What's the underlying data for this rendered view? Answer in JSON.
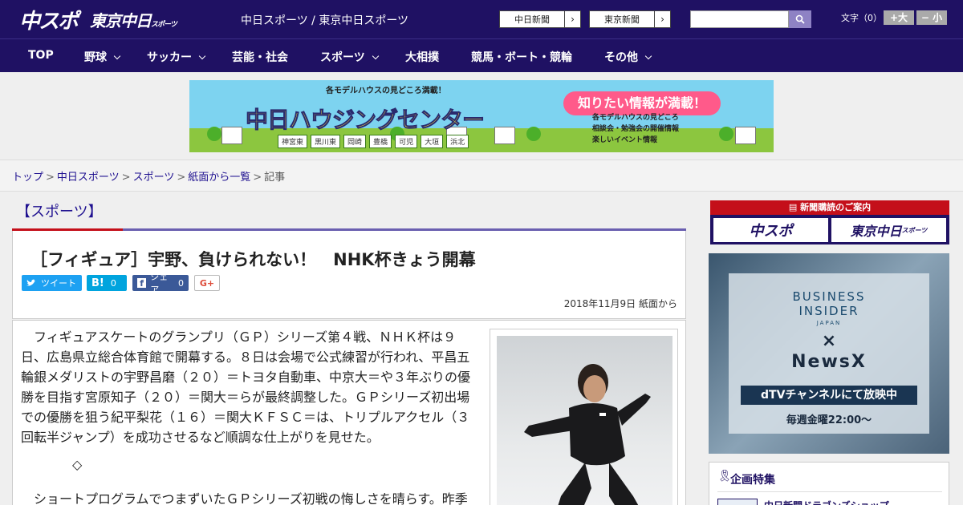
{
  "header": {
    "logo_primary": "中スポ",
    "logo_secondary": "東京中日",
    "logo_secondary_small": "スポーツ",
    "site_title": "中日スポーツ / 東京中日スポーツ",
    "link_chunichi": "中日新聞",
    "link_tokyo": "東京新聞",
    "search_placeholder": "",
    "fontsize_label": "文字（0）",
    "fontsize_up": "+大",
    "fontsize_down": "− 小"
  },
  "nav": {
    "items": [
      {
        "label": "TOP"
      },
      {
        "label": "野球"
      },
      {
        "label": "サッカー"
      },
      {
        "label": "芸能・社会"
      },
      {
        "label": "スポーツ"
      },
      {
        "label": "大相撲"
      },
      {
        "label": "競馬・ボート・競輪"
      },
      {
        "label": "その他"
      }
    ]
  },
  "banner": {
    "tagline": "各モデルハウスの見どころ満載！",
    "title": "中日ハウジングセンター",
    "pill": "知りたい情報が満載！",
    "info": [
      "各モデルハウスの見どころ",
      "相談会・勉強会の開催情報",
      "楽しいイベント情報"
    ],
    "towns": [
      "神宮東",
      "黒川東",
      "岡崎",
      "豊橋",
      "可児",
      "大垣",
      "浜北"
    ]
  },
  "breadcrumb": {
    "items": [
      "トップ",
      "中日スポーツ",
      "スポーツ",
      "紙面から一覧"
    ],
    "current": "記事"
  },
  "section": {
    "label": "【スポーツ】"
  },
  "article": {
    "headline": "［フィギュア］宇野、負けられない！　NHK杯きょう開幕",
    "share": {
      "tweet": "ツイート",
      "hatena_count": "0",
      "facebook": "シェア",
      "facebook_count": "0",
      "gplus": "G+"
    },
    "date": "2018年11月9日 紙面から",
    "para1": "フィギュアスケートのグランプリ（ＧＰ）シリーズ第４戦、ＮＨＫ杯は９日、広島県立総合体育館で開幕する。８日は会場で公式練習が行われ、平昌五輪銀メダリストの宇野昌磨（２０）＝トヨタ自動車、中京大＝や３年ぶりの優勝を目指す宮原知子（２０）＝関大＝らが最終調整した。ＧＰシリーズ初出場での優勝を狙う紀平梨花（１６）＝関大ＫＦＳＣ＝は、トリプルアクセル（３回転半ジャンプ）を成功させるなど順調な仕上がりを見せた。",
    "divider": "◇",
    "para2": "ショートプログラムでつまずいたＧＰシリーズ初戦の悔しさを晴らす。昨季"
  },
  "sidebar": {
    "subscribe_head": "新聞購読のご案内",
    "subscribe_logo1": "中スポ",
    "subscribe_logo2": "東京中日",
    "subscribe_logo2_small": "スポーツ",
    "ad": {
      "line1": "BUSINESS",
      "line2": "INSIDER",
      "line3": "JAPAN",
      "x": "×",
      "brand": "NewsX",
      "channel": "dTVチャンネルにて放映中",
      "time": "毎週金曜22:00〜"
    },
    "kikaku_title": "企画特集",
    "kikaku_item": "中日新聞ドラゴンズショップ"
  },
  "colors": {
    "header_bg": "#1f1163",
    "accent_red": "#c40f1a",
    "link": "#1f1190"
  }
}
